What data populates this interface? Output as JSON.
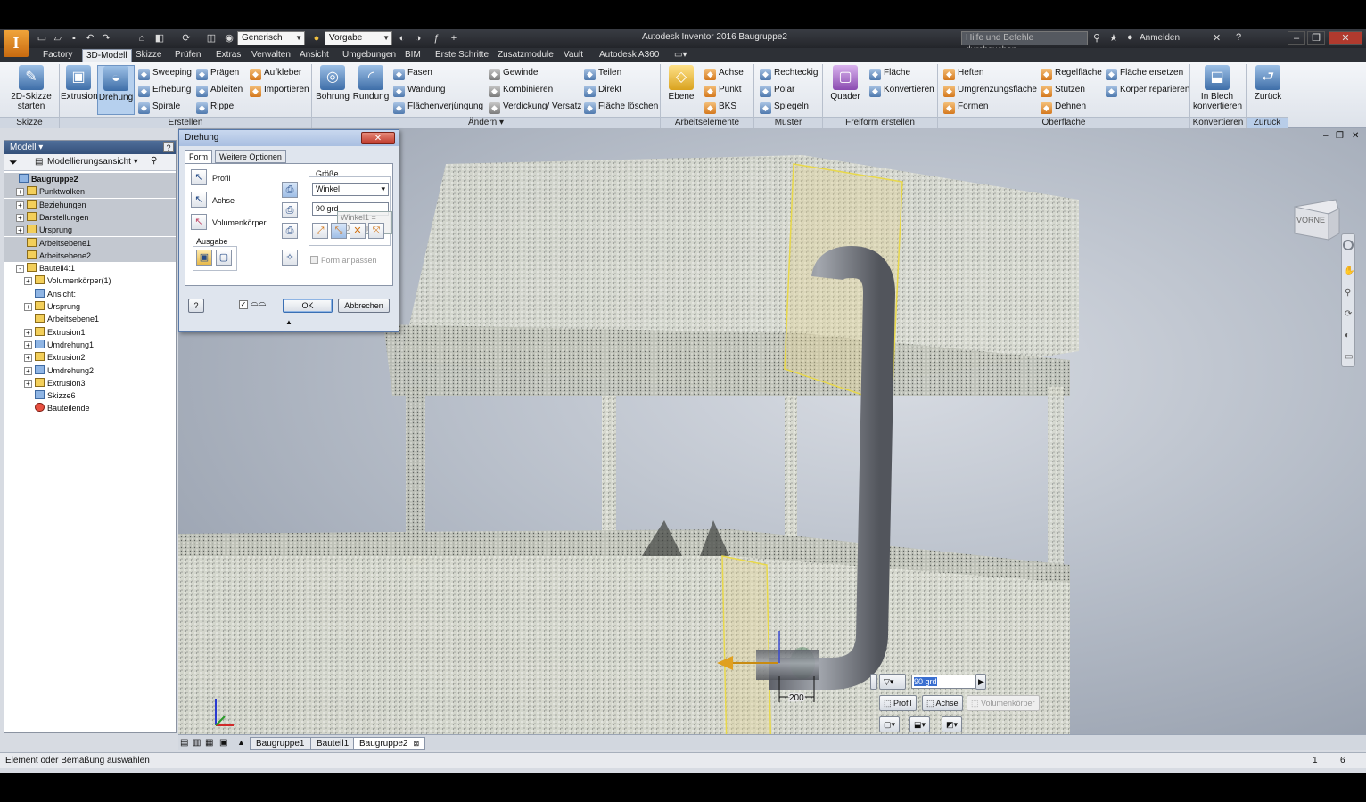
{
  "app": {
    "logo": "I",
    "title": "Autodesk Inventor 2016   Baugruppe2",
    "material_combo": "Generisch",
    "appearance_combo": "Vorgabe",
    "help_search_placeholder": "Hilfe und Befehle durchsuchen...",
    "signin": "Anmelden"
  },
  "menu_tabs": [
    "Factory",
    "3D-Modell",
    "Skizze",
    "Prüfen",
    "Extras",
    "Verwalten",
    "Ansicht",
    "Umgebungen",
    "BIM",
    "Erste Schritte",
    "Zusatzmodule",
    "Vault",
    "Autodesk A360"
  ],
  "active_tab": "3D-Modell",
  "ribbon": {
    "skizze": {
      "label": "Skizze",
      "btn_line1": "2D-Skizze",
      "btn_line2": "starten"
    },
    "erstellen": {
      "label": "Erstellen",
      "extrusion": "Extrusion",
      "drehung": "Drehung",
      "col1": [
        "Sweeping",
        "Erhebung",
        "Spirale"
      ],
      "col2": [
        "Prägen",
        "Ableiten",
        "Rippe"
      ],
      "col3": [
        "Aufkleber",
        "Importieren"
      ]
    },
    "aendern": {
      "label": "Ändern",
      "bohrung": "Bohrung",
      "rundung": "Rundung",
      "col1": [
        "Fasen",
        "Wandung",
        "Flächenverjüngung"
      ],
      "col2": [
        "Gewinde",
        "Kombinieren",
        "Verdickung/ Versatz"
      ],
      "col3": [
        "Teilen",
        "Direkt",
        "Fläche löschen"
      ]
    },
    "arbeitselemente": {
      "label": "Arbeitselemente",
      "ebene": "Ebene",
      "items": [
        "Achse",
        "Punkt",
        "BKS"
      ]
    },
    "muster": {
      "label": "Muster",
      "items": [
        "Rechteckig",
        "Polar",
        "Spiegeln"
      ]
    },
    "freiform": {
      "label": "Freiform erstellen",
      "quader": "Quader",
      "items": [
        "Fläche",
        "Konvertieren"
      ]
    },
    "oberflaeche": {
      "label": "Oberfläche",
      "col1": [
        "Heften",
        "Umgrenzungsfläche",
        "Formen"
      ],
      "col2": [
        "Regelfläche",
        "Stutzen",
        "Dehnen"
      ],
      "col3": [
        "Fläche ersetzen",
        "Körper reparieren"
      ]
    },
    "konvertieren": {
      "label": "Konvertieren",
      "line1": "In Blech",
      "line2": "konvertieren"
    },
    "zurueck": {
      "label": "Zurück",
      "btn": "Zurück"
    }
  },
  "browser": {
    "title": "Modell",
    "view": "Modellierungsansicht",
    "tree": [
      {
        "label": "Baugruppe2",
        "indent": 0,
        "pm": "",
        "sel": true,
        "icon": "blue",
        "bold": true
      },
      {
        "label": "Punktwolken",
        "indent": 1,
        "pm": "+",
        "sel": true,
        "icon": "folder"
      },
      {
        "label": "Beziehungen",
        "indent": 1,
        "pm": "+",
        "sel": true,
        "icon": "folder"
      },
      {
        "label": "Darstellungen",
        "indent": 1,
        "pm": "+",
        "sel": true,
        "icon": "folder"
      },
      {
        "label": "Ursprung",
        "indent": 1,
        "pm": "+",
        "sel": true,
        "icon": "folder"
      },
      {
        "label": "Arbeitsebene1",
        "indent": 1,
        "pm": "",
        "sel": true,
        "icon": "folder"
      },
      {
        "label": "Arbeitsebene2",
        "indent": 1,
        "pm": "",
        "sel": true,
        "icon": "folder"
      },
      {
        "label": "Bauteil4:1",
        "indent": 1,
        "pm": "-",
        "sel": false,
        "icon": "folder"
      },
      {
        "label": "Volumenkörper(1)",
        "indent": 2,
        "pm": "+",
        "sel": false,
        "icon": "folder"
      },
      {
        "label": "Ansicht:",
        "indent": 2,
        "pm": "",
        "sel": false,
        "icon": "blue"
      },
      {
        "label": "Ursprung",
        "indent": 2,
        "pm": "+",
        "sel": false,
        "icon": "folder"
      },
      {
        "label": "Arbeitsebene1",
        "indent": 2,
        "pm": "",
        "sel": false,
        "icon": "folder"
      },
      {
        "label": "Extrusion1",
        "indent": 2,
        "pm": "+",
        "sel": false,
        "icon": "folder"
      },
      {
        "label": "Umdrehung1",
        "indent": 2,
        "pm": "+",
        "sel": false,
        "icon": "blue"
      },
      {
        "label": "Extrusion2",
        "indent": 2,
        "pm": "+",
        "sel": false,
        "icon": "folder"
      },
      {
        "label": "Umdrehung2",
        "indent": 2,
        "pm": "+",
        "sel": false,
        "icon": "blue"
      },
      {
        "label": "Extrusion3",
        "indent": 2,
        "pm": "+",
        "sel": false,
        "icon": "folder"
      },
      {
        "label": "Skizze6",
        "indent": 2,
        "pm": "",
        "sel": false,
        "icon": "blue"
      },
      {
        "label": "Bauteilende",
        "indent": 2,
        "pm": "",
        "sel": false,
        "icon": "red"
      }
    ]
  },
  "dialog": {
    "title": "Drehung",
    "close": "✕",
    "tabs": [
      "Form",
      "Weitere Optionen"
    ],
    "profil": "Profil",
    "achse": "Achse",
    "volumenkoerper": "Volumenkörper",
    "ausgabe": "Ausgabe",
    "groesse": "Größe",
    "type_value": "Winkel",
    "angle_value": "90 grd",
    "angle_tooltip": "Winkel1 = 90,00 grd",
    "form_anpassen": "Form anpassen",
    "ok": "OK",
    "cancel": "Abbrechen",
    "help": "?"
  },
  "viewcube": {
    "face": "VORNE"
  },
  "viewport": {
    "dimension": "200",
    "mini_toolbar": {
      "value": "90 grd",
      "profil": "Profil",
      "achse": "Achse",
      "volumenkoerper": "Volumenkörper"
    }
  },
  "doc_tabs": [
    "Baugruppe1",
    "Bauteil1",
    "Baugruppe2"
  ],
  "active_doc": "Baugruppe2",
  "status": {
    "text": "Element oder Bemaßung auswählen",
    "count1": "1",
    "count2": "6"
  },
  "colors": {
    "accent": "#3e6ea8",
    "pipe": "#7d818a",
    "plane": "#e8d84a"
  }
}
